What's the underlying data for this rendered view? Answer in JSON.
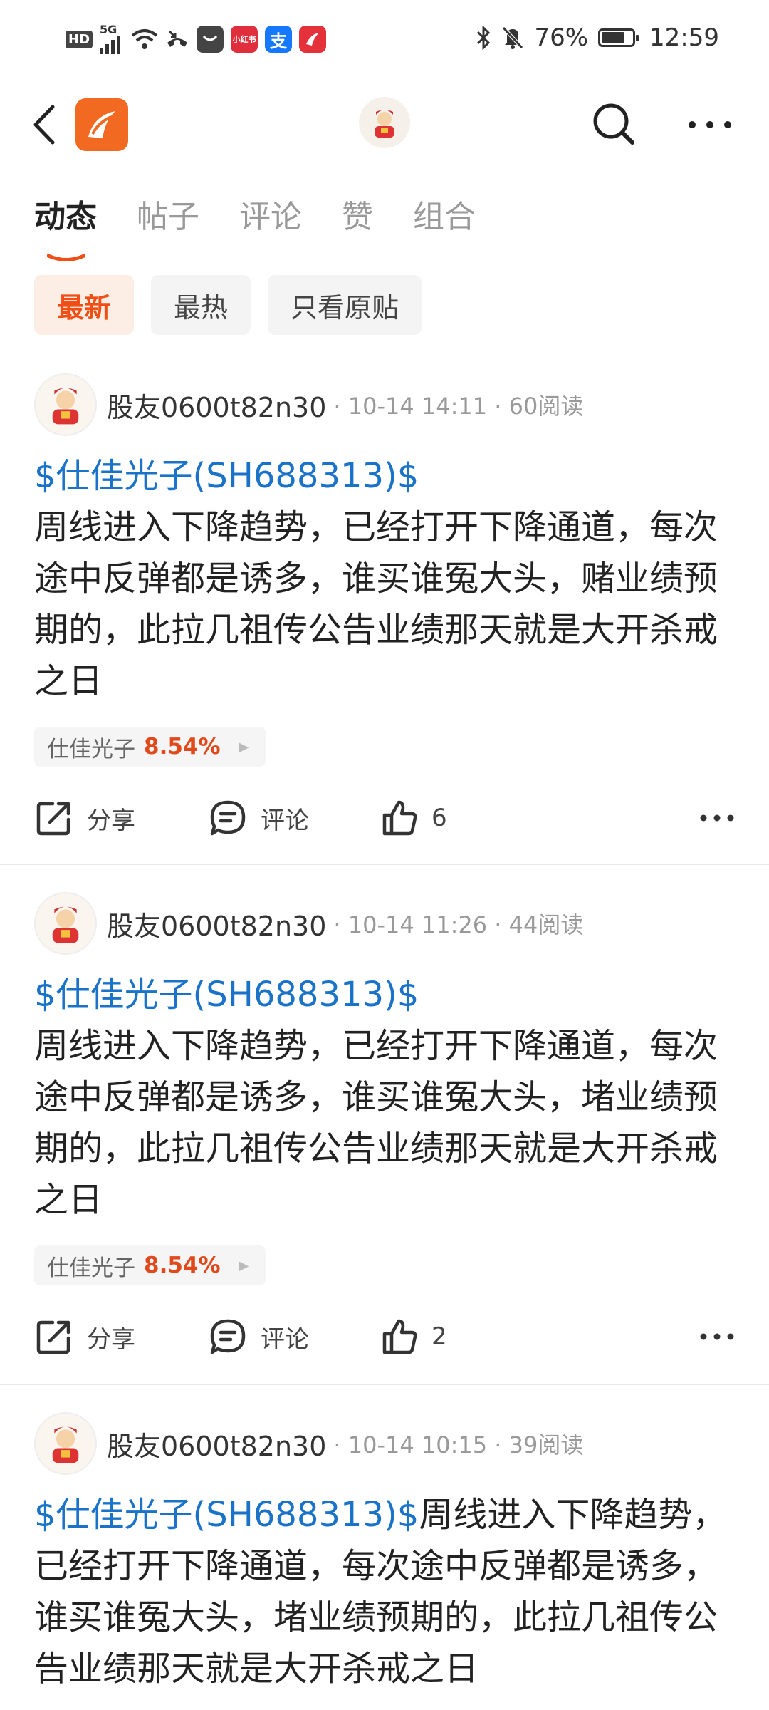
{
  "status_bar": {
    "left_labels": [
      "HD",
      "5G"
    ],
    "app_icons": [
      {
        "name": "message-app-icon",
        "label": "",
        "color": "#444444"
      },
      {
        "name": "xiaohongshu-app-icon",
        "label": "小红书",
        "color": "#e02e3c"
      },
      {
        "name": "alipay-app-icon",
        "label": "支",
        "color": "#1677ff"
      },
      {
        "name": "eastmoney-app-icon",
        "label": "",
        "color": "#e5313a"
      }
    ],
    "battery_level": 0.76,
    "battery_text": "76%",
    "time": "12:59"
  },
  "tabs": [
    {
      "label": "动态",
      "active": true
    },
    {
      "label": "帖子",
      "active": false
    },
    {
      "label": "评论",
      "active": false
    },
    {
      "label": "赞",
      "active": false
    },
    {
      "label": "组合",
      "active": false
    }
  ],
  "filters": [
    {
      "label": "最新",
      "active": true
    },
    {
      "label": "最热",
      "active": false
    },
    {
      "label": "只看原贴",
      "active": false
    }
  ],
  "posts": [
    {
      "username": "股友0600t82n30",
      "meta": "· 10-14 14:11 · 60阅读",
      "stock_link": "$仕佳光子(SH688313)$",
      "text": "周线进入下降趋势，已经打开下降通道，每次途中反弹都是诱多，谁买谁冤大头，赌业绩预期的，此拉几祖传公告业绩那天就是大开杀戒之日",
      "stock_name": "仕佳光子",
      "stock_change": "8.54%",
      "share_label": "分享",
      "comment_label": "评论",
      "like_count": "6"
    },
    {
      "username": "股友0600t82n30",
      "meta": "· 10-14 11:26 · 44阅读",
      "stock_link": "$仕佳光子(SH688313)$",
      "text": "周线进入下降趋势，已经打开下降通道，每次途中反弹都是诱多，谁买谁冤大头，堵业绩预期的，此拉几祖传公告业绩那天就是大开杀戒之日",
      "stock_name": "仕佳光子",
      "stock_change": "8.54%",
      "share_label": "分享",
      "comment_label": "评论",
      "like_count": "2"
    },
    {
      "username": "股友0600t82n30",
      "meta": "· 10-14 10:15 · 39阅读",
      "stock_link": "$仕佳光子(SH688313)$",
      "text": "周线进入下降趋势，已经打开下降通道，每次途中反弹都是诱多，谁买谁冤大头，堵业绩预期的，此拉几祖传公告业绩那天就是大开杀戒之日"
    }
  ],
  "colors": {
    "accent": "#f04e14",
    "link": "#1a73c8",
    "percent_up": "#e0491c"
  }
}
